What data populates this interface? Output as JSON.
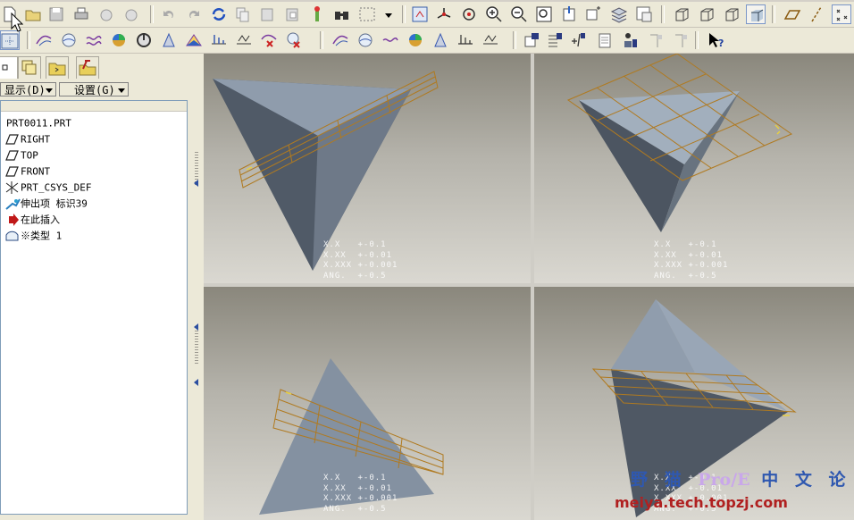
{
  "toolbar_top": {
    "icons": [
      "new-icon",
      "open-icon",
      "save-icon",
      "print-icon",
      "send-icon",
      "mail-icon",
      "undo-icon",
      "redo-icon",
      "regenerate-icon",
      "copy-icon",
      "paste-icon",
      "paste-special-icon",
      "delete-icon",
      "find-icon",
      "select-box-icon",
      "dropdown-icon",
      "view-manager-icon",
      "spin-center-icon",
      "orient-icon",
      "zoom-in-icon",
      "zoom-out-icon",
      "refit-icon",
      "repaint-icon",
      "layers-icon",
      "named-view-icon",
      "model-tree-icon",
      "wireframe-icon",
      "hidden-line-icon",
      "no-hidden-icon",
      "shading-icon",
      "plane-display-icon",
      "axis-display-icon",
      "point-display-icon"
    ]
  },
  "toolbar_bottom": {
    "icons": [
      "datum-plane-icon",
      "datum-axis-icon",
      "datum-curve-icon",
      "datum-point-icon",
      "datum-csys-icon",
      "sketch-icon",
      "analysis-icon",
      "measure-icon",
      "curvature-icon",
      "surface-analysis-icon",
      "draft-analysis-icon",
      "dihedral-icon",
      "graph-icon",
      "delete-analysis-icon",
      "analysis-plane-icon",
      "analysis-axis-icon",
      "analysis-curve-icon",
      "shaded-curvature-icon",
      "slope-icon",
      "reflection-icon",
      "analysis-measure-icon",
      "info-feature-icon",
      "info-model-icon",
      "relations-icon",
      "parameters-icon",
      "family-table-icon",
      "setup-icon",
      "whats-this-icon"
    ]
  },
  "left_panel": {
    "tabs": [
      "model-tree-tab",
      "layers-tab",
      "folder-tab",
      "favorites-tab"
    ],
    "display_menu": "显示(D)",
    "settings_menu": "设置(G)"
  },
  "model_tree": [
    {
      "label": "PRT0011.PRT",
      "icon": "part-icon"
    },
    {
      "label": "RIGHT",
      "icon": "datum-plane-icon"
    },
    {
      "label": "TOP",
      "icon": "datum-plane-icon"
    },
    {
      "label": "FRONT",
      "icon": "datum-plane-icon"
    },
    {
      "label": "PRT_CSYS_DEF",
      "icon": "csys-icon"
    },
    {
      "label": "伸出项 标识39",
      "icon": "protrusion-icon"
    },
    {
      "label": "在此插入",
      "icon": "insert-here-icon"
    },
    {
      "label": "※类型 1",
      "icon": "feature-type-icon"
    }
  ],
  "tolerance_block": [
    "X.X   +-0.1",
    "X.XX  +-0.01",
    "X.XXX +-0.001",
    "ANG.  +-0.5"
  ],
  "watermark": {
    "brand_prefix": "野 猫",
    "brand_highlight": "Pro/E",
    "brand_suffix": "中 文 论 坛",
    "url": "meiya.tech.topzj.com"
  },
  "colors": {
    "toolbar_bg": "#ece9d8",
    "face_light": "#8c99aa",
    "face_dark": "#4a525e",
    "datum_plane": "#b07a20",
    "brand_blue": "#2f58b0",
    "brand_red": "#b02020"
  }
}
